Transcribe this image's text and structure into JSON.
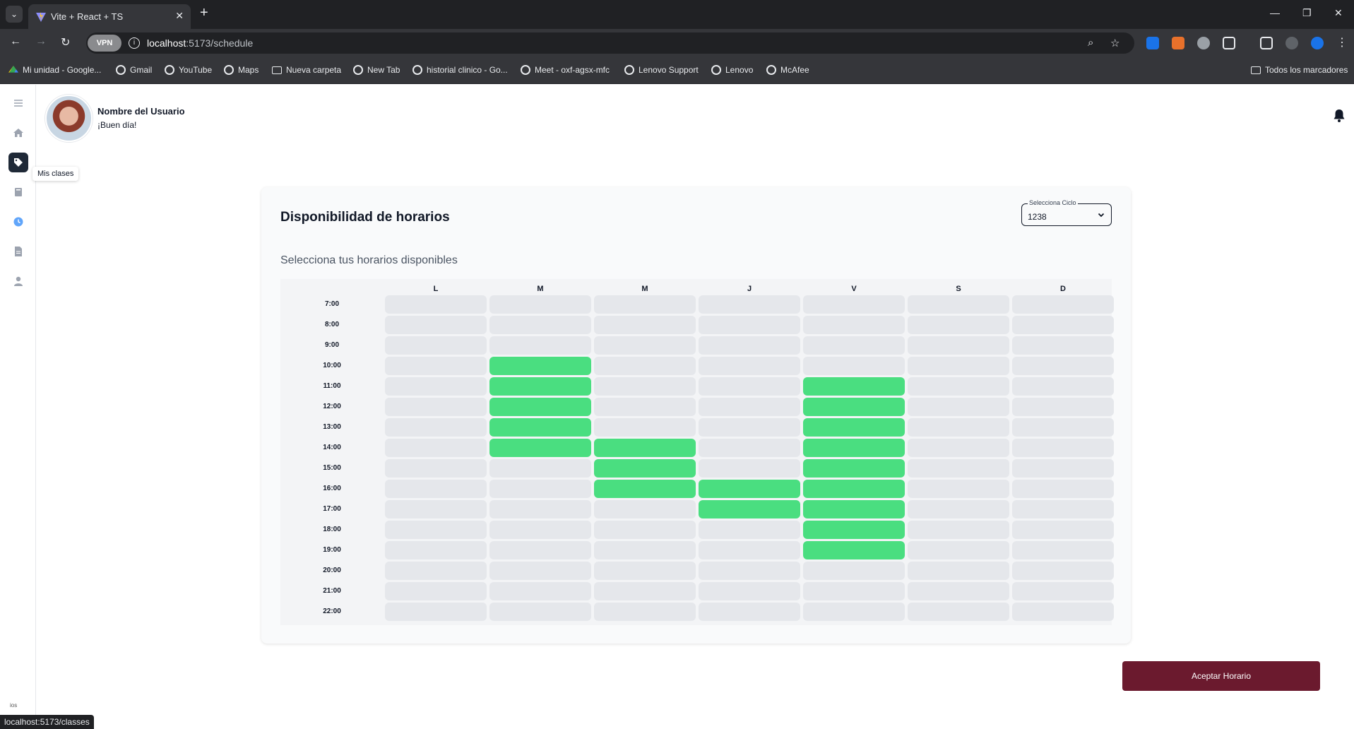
{
  "browser": {
    "tab_title": "Vite + React + TS",
    "url_host": "localhost",
    "url_path": ":5173/schedule",
    "vpn_label": "VPN",
    "status_url": "localhost:5173/classes",
    "bookmarks": [
      {
        "label": "Mi unidad - Google...",
        "icon": "drive-icon"
      },
      {
        "label": "Gmail",
        "icon": "globe-icon"
      },
      {
        "label": "YouTube",
        "icon": "globe-icon"
      },
      {
        "label": "Maps",
        "icon": "globe-icon"
      },
      {
        "label": "Nueva carpeta",
        "icon": "folder-icon"
      },
      {
        "label": "New Tab",
        "icon": "globe-icon"
      },
      {
        "label": "historial clinico - Go...",
        "icon": "globe-icon"
      },
      {
        "label": "Meet - oxf-agsx-mfc",
        "icon": "globe-icon"
      },
      {
        "label": "Lenovo Support",
        "icon": "globe-icon"
      },
      {
        "label": "Lenovo",
        "icon": "globe-icon"
      },
      {
        "label": "McAfee",
        "icon": "globe-icon"
      }
    ],
    "all_bookmarks": "Todos los marcadores"
  },
  "sidebar": {
    "tooltip": "Mis clases",
    "logo_text": "ios",
    "items": [
      "home-icon",
      "tag-icon",
      "book-icon",
      "clock-icon",
      "document-icon",
      "user-icon"
    ]
  },
  "header": {
    "user_name": "Nombre del Usuario",
    "greeting": "¡Buen día!"
  },
  "schedule": {
    "title": "Disponibilidad de horarios",
    "subtitle": "Selecciona tus horarios disponibles",
    "select_label": "Selecciona Ciclo",
    "select_value": "1238",
    "days": [
      "L",
      "M",
      "M",
      "J",
      "V",
      "S",
      "D"
    ],
    "hours": [
      "7:00",
      "8:00",
      "9:00",
      "10:00",
      "11:00",
      "12:00",
      "13:00",
      "14:00",
      "15:00",
      "16:00",
      "17:00",
      "18:00",
      "19:00",
      "20:00",
      "21:00",
      "22:00"
    ],
    "selected": [
      [
        0,
        0,
        0,
        0,
        0,
        0,
        0
      ],
      [
        0,
        0,
        0,
        0,
        0,
        0,
        0
      ],
      [
        0,
        0,
        0,
        0,
        0,
        0,
        0
      ],
      [
        0,
        1,
        0,
        0,
        0,
        0,
        0
      ],
      [
        0,
        1,
        0,
        0,
        1,
        0,
        0
      ],
      [
        0,
        1,
        0,
        0,
        1,
        0,
        0
      ],
      [
        0,
        1,
        0,
        0,
        1,
        0,
        0
      ],
      [
        0,
        1,
        1,
        0,
        1,
        0,
        0
      ],
      [
        0,
        0,
        1,
        0,
        1,
        0,
        0
      ],
      [
        0,
        0,
        1,
        1,
        1,
        0,
        0
      ],
      [
        0,
        0,
        0,
        1,
        1,
        0,
        0
      ],
      [
        0,
        0,
        0,
        0,
        1,
        0,
        0
      ],
      [
        0,
        0,
        0,
        0,
        1,
        0,
        0
      ],
      [
        0,
        0,
        0,
        0,
        0,
        0,
        0
      ],
      [
        0,
        0,
        0,
        0,
        0,
        0,
        0
      ],
      [
        0,
        0,
        0,
        0,
        0,
        0,
        0
      ]
    ],
    "selected_color": "#4ade80",
    "empty_color": "#e5e7eb",
    "accept_label": "Aceptar Horario",
    "accept_color": "#6b1a2e"
  }
}
